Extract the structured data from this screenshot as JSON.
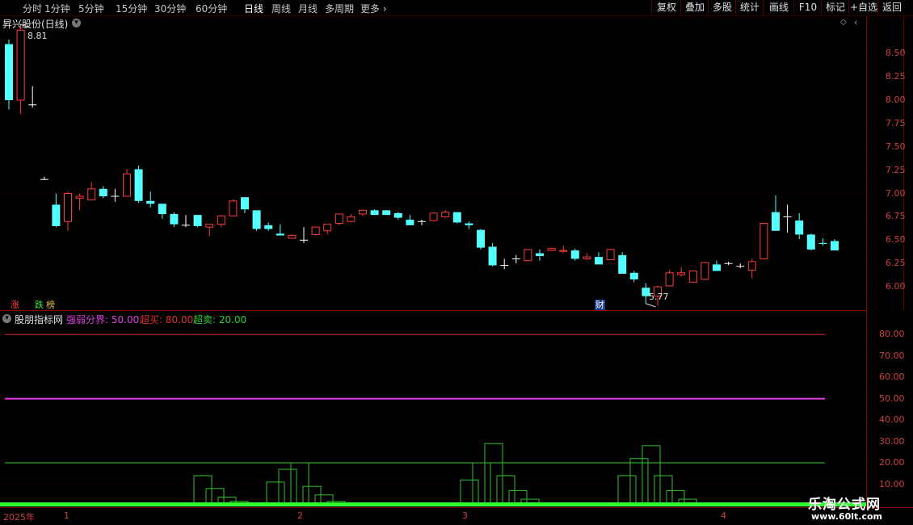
{
  "toolbar": {
    "timeframes": [
      "分时",
      "1分钟",
      "5分钟",
      "15分钟",
      "30分钟",
      "60分钟",
      "日线",
      "周线",
      "月线",
      "多周期",
      "更多"
    ],
    "active_timeframe": "日线",
    "right_buttons": [
      "复权",
      "叠加",
      "多股",
      "统计",
      "画线",
      "F10",
      "标记",
      "+自选",
      "返回"
    ]
  },
  "main_chart": {
    "title": "昇兴股份(日线)",
    "high_label": "8.81",
    "low_label": "5.77",
    "tags": {
      "up": "涨",
      "down": "跌",
      "list": "榜",
      "finance": "财"
    },
    "y_ticks": [
      "8.50",
      "8.25",
      "8.00",
      "7.75",
      "7.50",
      "7.25",
      "7.00",
      "6.75",
      "6.50",
      "6.25",
      "6.00"
    ]
  },
  "indicator": {
    "name": "股朋指标网",
    "params": [
      {
        "label": "强弱分界",
        "value": "50.00",
        "color": "#e040e0"
      },
      {
        "label": "超买",
        "value": "80.00",
        "color": "#e03030"
      },
      {
        "label": "超卖",
        "value": "20.00",
        "color": "#30d030"
      }
    ],
    "y_ticks": [
      "80.00",
      "70.00",
      "60.00",
      "50.00",
      "40.00",
      "30.00",
      "20.00",
      "10.00"
    ]
  },
  "x_axis": {
    "labels": [
      "2025年",
      "1",
      "2",
      "3",
      "4"
    ]
  },
  "watermark": {
    "brand": "乐淘公式网",
    "url": "www.60lt.com"
  },
  "colors": {
    "up": "#ff3b3b",
    "down": "#54ffff",
    "grid": "#8b0000",
    "strong_weak": "#e040e0",
    "overbought": "#e03030",
    "oversold": "#30d030"
  },
  "chart_data": [
    {
      "type": "candlestick",
      "title": "昇兴股份(日线)",
      "ylim": [
        5.75,
        8.9
      ],
      "candles": [
        [
          8.6,
          8.65,
          7.9,
          8.0
        ],
        [
          8.0,
          8.81,
          7.85,
          8.75
        ],
        [
          7.95,
          8.15,
          7.92,
          7.95
        ],
        [
          7.15,
          7.18,
          7.15,
          7.15
        ],
        [
          6.88,
          7.0,
          6.64,
          6.65
        ],
        [
          6.7,
          7.02,
          6.6,
          7.0
        ],
        [
          6.95,
          7.0,
          6.82,
          6.97
        ],
        [
          6.93,
          7.12,
          6.93,
          7.05
        ],
        [
          7.05,
          7.08,
          6.95,
          6.97
        ],
        [
          6.97,
          7.05,
          6.91,
          6.97
        ],
        [
          6.97,
          7.26,
          6.97,
          7.21
        ],
        [
          7.26,
          7.3,
          6.9,
          6.92
        ],
        [
          6.92,
          7.02,
          6.85,
          6.89
        ],
        [
          6.89,
          6.89,
          6.73,
          6.78
        ],
        [
          6.78,
          6.8,
          6.64,
          6.67
        ],
        [
          6.66,
          6.77,
          6.64,
          6.66
        ],
        [
          6.77,
          6.77,
          6.64,
          6.65
        ],
        [
          6.64,
          6.67,
          6.54,
          6.67
        ],
        [
          6.67,
          6.77,
          6.64,
          6.76
        ],
        [
          6.76,
          6.94,
          6.76,
          6.92
        ],
        [
          6.96,
          6.96,
          6.79,
          6.83
        ],
        [
          6.82,
          6.82,
          6.6,
          6.62
        ],
        [
          6.66,
          6.69,
          6.6,
          6.62
        ],
        [
          6.57,
          6.67,
          6.55,
          6.55
        ],
        [
          6.52,
          6.56,
          6.52,
          6.55
        ],
        [
          6.5,
          6.64,
          6.47,
          6.5
        ],
        [
          6.56,
          6.6,
          6.55,
          6.64
        ],
        [
          6.6,
          6.65,
          6.56,
          6.67
        ],
        [
          6.68,
          6.78,
          6.66,
          6.78
        ],
        [
          6.7,
          6.78,
          6.69,
          6.75
        ],
        [
          6.78,
          6.83,
          6.76,
          6.82
        ],
        [
          6.82,
          6.83,
          6.77,
          6.77
        ],
        [
          6.82,
          6.82,
          6.77,
          6.77
        ],
        [
          6.79,
          6.8,
          6.72,
          6.74
        ],
        [
          6.72,
          6.77,
          6.66,
          6.66
        ],
        [
          6.7,
          6.72,
          6.66,
          6.7
        ],
        [
          6.71,
          6.79,
          6.7,
          6.79
        ],
        [
          6.75,
          6.82,
          6.74,
          6.8
        ],
        [
          6.8,
          6.8,
          6.68,
          6.69
        ],
        [
          6.68,
          6.7,
          6.62,
          6.66
        ],
        [
          6.61,
          6.62,
          6.4,
          6.42
        ],
        [
          6.43,
          6.47,
          6.22,
          6.23
        ],
        [
          6.23,
          6.3,
          6.19,
          6.23
        ],
        [
          6.3,
          6.34,
          6.25,
          6.3
        ],
        [
          6.28,
          6.4,
          6.28,
          6.4
        ],
        [
          6.36,
          6.4,
          6.28,
          6.33
        ],
        [
          6.39,
          6.42,
          6.38,
          6.41
        ],
        [
          6.38,
          6.44,
          6.36,
          6.39
        ],
        [
          6.39,
          6.41,
          6.28,
          6.3
        ],
        [
          6.3,
          6.36,
          6.29,
          6.32
        ],
        [
          6.32,
          6.37,
          6.24,
          6.24
        ],
        [
          6.29,
          6.41,
          6.29,
          6.4
        ],
        [
          6.34,
          6.37,
          6.15,
          6.14
        ],
        [
          6.15,
          6.17,
          6.05,
          6.08
        ],
        [
          5.99,
          6.04,
          5.82,
          5.9
        ],
        [
          5.9,
          6.01,
          5.8,
          6.0
        ],
        [
          6.01,
          6.18,
          6.01,
          6.15
        ],
        [
          6.13,
          6.21,
          6.11,
          6.15
        ],
        [
          6.05,
          6.17,
          6.05,
          6.17
        ],
        [
          6.08,
          6.26,
          6.08,
          6.26
        ],
        [
          6.24,
          6.28,
          6.17,
          6.17
        ],
        [
          6.25,
          6.27,
          6.23,
          6.25
        ],
        [
          6.22,
          6.25,
          6.2,
          6.22
        ],
        [
          6.18,
          6.3,
          6.09,
          6.27
        ],
        [
          6.3,
          6.67,
          6.3,
          6.68
        ],
        [
          6.8,
          6.98,
          6.61,
          6.6
        ],
        [
          6.75,
          6.88,
          6.58,
          6.75
        ],
        [
          6.71,
          6.79,
          6.51,
          6.56
        ],
        [
          6.56,
          6.57,
          6.39,
          6.4
        ],
        [
          6.47,
          6.52,
          6.44,
          6.46
        ],
        [
          6.49,
          6.51,
          6.39,
          6.39
        ]
      ]
    },
    {
      "type": "line",
      "title": "股朋指标网",
      "ylim": [
        0,
        88
      ],
      "reference_lines": [
        {
          "name": "强弱分界",
          "value": 50
        },
        {
          "name": "超买",
          "value": 80
        },
        {
          "name": "超卖",
          "value": 20
        }
      ],
      "bars": [
        {
          "x": 17,
          "value": 14
        },
        {
          "x": 18,
          "value": 8
        },
        {
          "x": 19,
          "value": 4
        },
        {
          "x": 20,
          "value": 2
        },
        {
          "x": 23,
          "value": 11
        },
        {
          "x": 24,
          "value": 17
        },
        {
          "x": 25,
          "value": 20
        },
        {
          "x": 26,
          "value": 9
        },
        {
          "x": 27,
          "value": 5
        },
        {
          "x": 28,
          "value": 2
        },
        {
          "x": 29,
          "value": 1
        },
        {
          "x": 39,
          "value": 12
        },
        {
          "x": 40,
          "value": 20
        },
        {
          "x": 41,
          "value": 29
        },
        {
          "x": 42,
          "value": 14
        },
        {
          "x": 43,
          "value": 7
        },
        {
          "x": 44,
          "value": 3
        },
        {
          "x": 45,
          "value": 1
        },
        {
          "x": 52,
          "value": 14
        },
        {
          "x": 53,
          "value": 22
        },
        {
          "x": 54,
          "value": 28
        },
        {
          "x": 55,
          "value": 14
        },
        {
          "x": 56,
          "value": 7
        },
        {
          "x": 57,
          "value": 3
        },
        {
          "x": 58,
          "value": 1
        }
      ]
    }
  ]
}
